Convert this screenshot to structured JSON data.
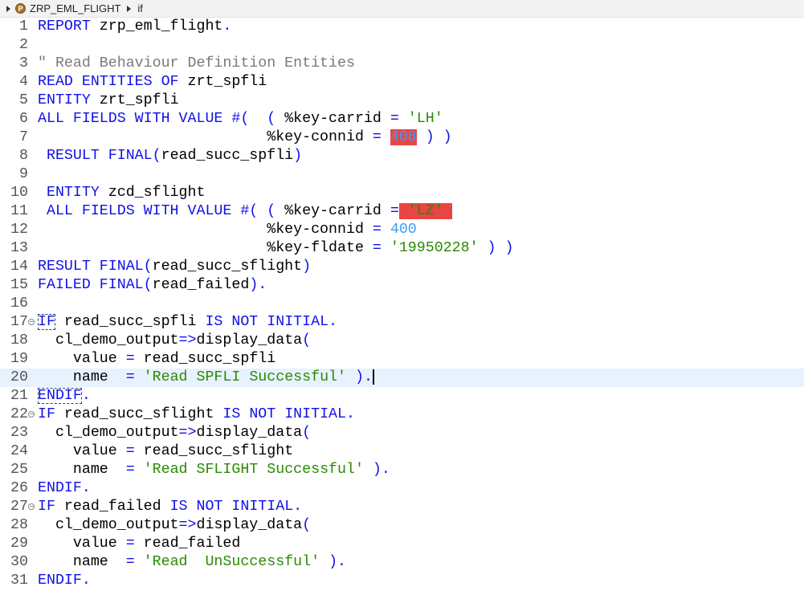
{
  "breadcrumb": {
    "items": [
      "ZRP_EML_FLIGHT",
      "if"
    ],
    "icon": "abap-program-icon",
    "icon_letter": "P"
  },
  "colors": {
    "keyword": "#1010e8",
    "string": "#2a8a00",
    "number": "#3d9bf5",
    "comment": "#7a7a7a",
    "error_highlight": "#e84545",
    "current_line": "#e8f2fe"
  },
  "editor": {
    "current_line": 20,
    "lines": [
      [
        [
          "kw",
          "REPORT"
        ],
        [
          "id",
          " zrp_eml_flight"
        ],
        [
          "kw",
          "."
        ]
      ],
      [],
      [
        [
          "cm",
          "\" Read Behaviour Definition Entities"
        ]
      ],
      [
        [
          "kw",
          "READ ENTITIES OF"
        ],
        [
          "id",
          " zrt_spfli"
        ]
      ],
      [
        [
          "kw",
          "ENTITY"
        ],
        [
          "id",
          " zrt_spfli"
        ]
      ],
      [
        [
          "kw",
          "ALL FIELDS WITH VALUE #(  ( "
        ],
        [
          "id",
          "%key-carrid "
        ],
        [
          "kw",
          "= "
        ],
        [
          "str",
          "'LH'"
        ]
      ],
      [
        [
          "id",
          "                          %key-connid "
        ],
        [
          "kw",
          "= "
        ],
        [
          "num hl",
          "408"
        ],
        [
          "kw",
          " ) )"
        ]
      ],
      [
        [
          "kw",
          " RESULT FINAL("
        ],
        [
          "id",
          "read_succ_spfli"
        ],
        [
          "kw",
          ")"
        ]
      ],
      [],
      [
        [
          "kw",
          " ENTITY"
        ],
        [
          "id",
          " zcd_sflight"
        ]
      ],
      [
        [
          "kw",
          " ALL FIELDS WITH VALUE #( ( "
        ],
        [
          "id",
          "%key-carrid "
        ],
        [
          "kw",
          "="
        ],
        [
          "str hl",
          " 'LZ' "
        ]
      ],
      [
        [
          "id",
          "                          %key-connid "
        ],
        [
          "kw",
          "= "
        ],
        [
          "num",
          "400"
        ]
      ],
      [
        [
          "id",
          "                          %key-fldate "
        ],
        [
          "kw",
          "= "
        ],
        [
          "str",
          "'19950228'"
        ],
        [
          "kw",
          " ) )"
        ]
      ],
      [
        [
          "kw",
          "RESULT FINAL("
        ],
        [
          "id",
          "read_succ_sflight"
        ],
        [
          "kw",
          ")"
        ]
      ],
      [
        [
          "kw",
          "FAILED FINAL("
        ],
        [
          "id",
          "read_failed"
        ],
        [
          "kw",
          ")."
        ]
      ],
      [],
      [
        [
          "kw box",
          "IF"
        ],
        [
          "id",
          " read_succ_spfli "
        ],
        [
          "kw",
          "IS NOT INITIAL."
        ]
      ],
      [
        [
          "id",
          "  cl_demo_output"
        ],
        [
          "kw",
          "=>"
        ],
        [
          "id",
          "display_data"
        ],
        [
          "kw",
          "("
        ]
      ],
      [
        [
          "id",
          "    value "
        ],
        [
          "kw",
          "="
        ],
        [
          "id",
          " read_succ_spfli"
        ]
      ],
      [
        [
          "id",
          "    name  "
        ],
        [
          "kw",
          "= "
        ],
        [
          "str",
          "'Read SPFLI Successful'"
        ],
        [
          "kw",
          " )."
        ]
      ],
      [
        [
          "kw box",
          "ENDIF"
        ],
        [
          "kw",
          "."
        ]
      ],
      [
        [
          "kw",
          "IF"
        ],
        [
          "id",
          " read_succ_sflight "
        ],
        [
          "kw",
          "IS NOT INITIAL."
        ]
      ],
      [
        [
          "id",
          "  cl_demo_output"
        ],
        [
          "kw",
          "=>"
        ],
        [
          "id",
          "display_data"
        ],
        [
          "kw",
          "("
        ]
      ],
      [
        [
          "id",
          "    value "
        ],
        [
          "kw",
          "="
        ],
        [
          "id",
          " read_succ_sflight"
        ]
      ],
      [
        [
          "id",
          "    name  "
        ],
        [
          "kw",
          "= "
        ],
        [
          "str",
          "'Read SFLIGHT Successful'"
        ],
        [
          "kw",
          " )."
        ]
      ],
      [
        [
          "kw",
          "ENDIF."
        ]
      ],
      [
        [
          "kw",
          "IF"
        ],
        [
          "id",
          " read_failed "
        ],
        [
          "kw",
          "IS NOT INITIAL."
        ]
      ],
      [
        [
          "id",
          "  cl_demo_output"
        ],
        [
          "kw",
          "=>"
        ],
        [
          "id",
          "display_data"
        ],
        [
          "kw",
          "("
        ]
      ],
      [
        [
          "id",
          "    value "
        ],
        [
          "kw",
          "="
        ],
        [
          "id",
          " read_failed"
        ]
      ],
      [
        [
          "id",
          "    name  "
        ],
        [
          "kw",
          "= "
        ],
        [
          "str",
          "'Read  UnSuccessful'"
        ],
        [
          "kw",
          " )."
        ]
      ],
      [
        [
          "kw",
          "ENDIF."
        ]
      ]
    ],
    "fold_lines": [
      17,
      22,
      27
    ]
  }
}
